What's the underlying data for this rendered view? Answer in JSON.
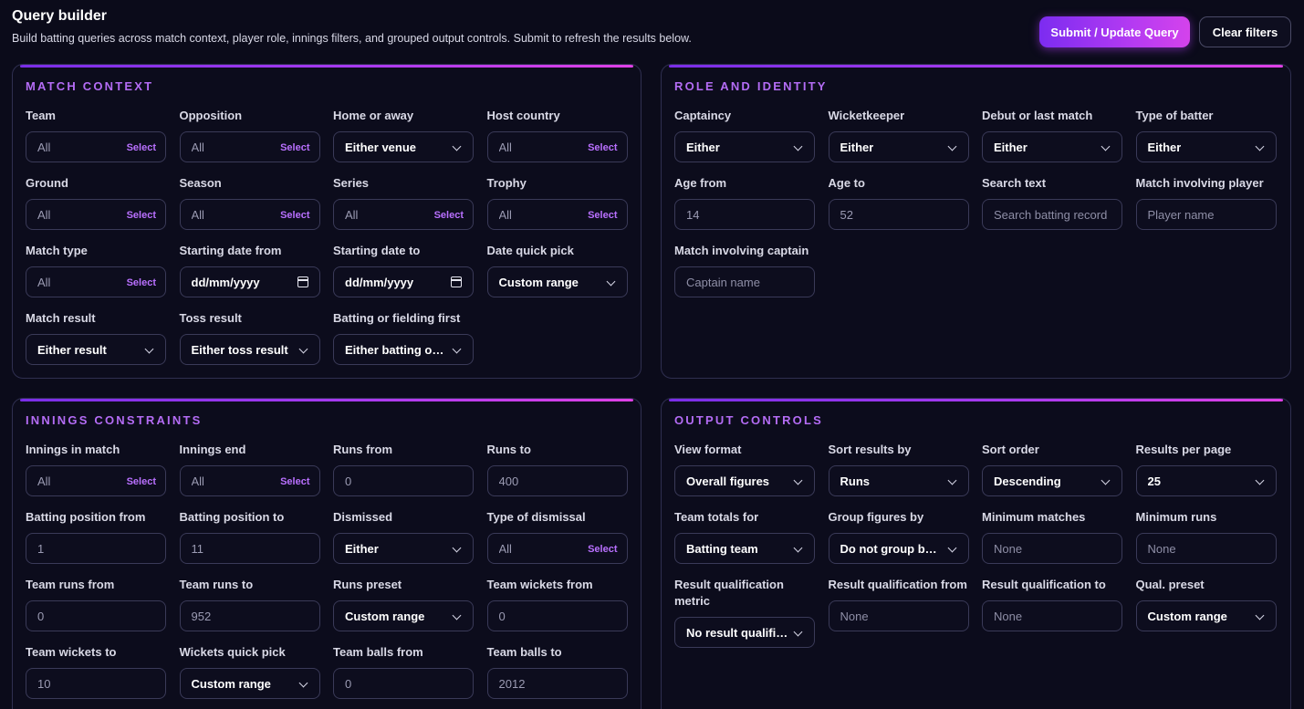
{
  "header": {
    "title": "Query builder",
    "subtitle": "Build batting queries across match context, player role, innings filters, and grouped output controls. Submit to refresh the results below.",
    "submit_label": "Submit / Update Query",
    "clear_label": "Clear filters"
  },
  "select_tag": "Select",
  "match_context": {
    "title": "MATCH CONTEXT",
    "fields": [
      {
        "label": "Team",
        "kind": "multi",
        "value": "All"
      },
      {
        "label": "Opposition",
        "kind": "multi",
        "value": "All"
      },
      {
        "label": "Home or away",
        "kind": "select",
        "value": "Either venue"
      },
      {
        "label": "Host country",
        "kind": "multi",
        "value": "All"
      },
      {
        "label": "Ground",
        "kind": "multi",
        "value": "All"
      },
      {
        "label": "Season",
        "kind": "multi",
        "value": "All"
      },
      {
        "label": "Series",
        "kind": "multi",
        "value": "All"
      },
      {
        "label": "Trophy",
        "kind": "multi",
        "value": "All"
      },
      {
        "label": "Match type",
        "kind": "multi",
        "value": "All"
      },
      {
        "label": "Starting date from",
        "kind": "date",
        "value": "dd/mm/yyyy"
      },
      {
        "label": "Starting date to",
        "kind": "date",
        "value": "dd/mm/yyyy"
      },
      {
        "label": "Date quick pick",
        "kind": "select",
        "value": "Custom range"
      },
      {
        "label": "Match result",
        "kind": "select",
        "value": "Either result"
      },
      {
        "label": "Toss result",
        "kind": "select",
        "value": "Either toss result"
      },
      {
        "label": "Batting or fielding first",
        "kind": "select",
        "value": "Either batting or fielding first"
      }
    ]
  },
  "role_identity": {
    "title": "ROLE AND IDENTITY",
    "fields": [
      {
        "label": "Captaincy",
        "kind": "select",
        "value": "Either"
      },
      {
        "label": "Wicketkeeper",
        "kind": "select",
        "value": "Either"
      },
      {
        "label": "Debut or last match",
        "kind": "select",
        "value": "Either"
      },
      {
        "label": "Type of batter",
        "kind": "select",
        "value": "Either"
      },
      {
        "label": "Age from",
        "kind": "input",
        "value": "14"
      },
      {
        "label": "Age to",
        "kind": "input",
        "value": "52"
      },
      {
        "label": "Search text",
        "kind": "input",
        "value": "",
        "placeholder": "Search batting record"
      },
      {
        "label": "Match involving player",
        "kind": "input",
        "value": "",
        "placeholder": "Player name"
      },
      {
        "label": "Match involving captain",
        "kind": "input",
        "value": "",
        "placeholder": "Captain name"
      }
    ]
  },
  "innings_constraints": {
    "title": "INNINGS CONSTRAINTS",
    "fields": [
      {
        "label": "Innings in match",
        "kind": "multi",
        "value": "All"
      },
      {
        "label": "Innings end",
        "kind": "multi",
        "value": "All"
      },
      {
        "label": "Runs from",
        "kind": "input",
        "value": "0"
      },
      {
        "label": "Runs to",
        "kind": "input",
        "value": "400"
      },
      {
        "label": "Batting position from",
        "kind": "input",
        "value": "1"
      },
      {
        "label": "Batting position to",
        "kind": "input",
        "value": "11"
      },
      {
        "label": "Dismissed",
        "kind": "select",
        "value": "Either"
      },
      {
        "label": "Type of dismissal",
        "kind": "multi",
        "value": "All"
      },
      {
        "label": "Team runs from",
        "kind": "input",
        "value": "0"
      },
      {
        "label": "Team runs to",
        "kind": "input",
        "value": "952"
      },
      {
        "label": "Runs preset",
        "kind": "select",
        "value": "Custom range"
      },
      {
        "label": "Team wickets from",
        "kind": "input",
        "value": "0"
      },
      {
        "label": "Team wickets to",
        "kind": "input",
        "value": "10"
      },
      {
        "label": "Wickets quick pick",
        "kind": "select",
        "value": "Custom range"
      },
      {
        "label": "Team balls from",
        "kind": "input",
        "value": "0"
      },
      {
        "label": "Team balls to",
        "kind": "input",
        "value": "2012"
      }
    ]
  },
  "output_controls": {
    "title": "OUTPUT CONTROLS",
    "fields": [
      {
        "label": "View format",
        "kind": "select",
        "value": "Overall figures"
      },
      {
        "label": "Sort results by",
        "kind": "select",
        "value": "Runs"
      },
      {
        "label": "Sort order",
        "kind": "select",
        "value": "Descending"
      },
      {
        "label": "Results per page",
        "kind": "select",
        "value": "25"
      },
      {
        "label": "Team totals for",
        "kind": "select",
        "value": "Batting team"
      },
      {
        "label": "Group figures by",
        "kind": "select",
        "value": "Do not group by anything"
      },
      {
        "label": "Minimum matches",
        "kind": "input",
        "value": "",
        "placeholder": "None"
      },
      {
        "label": "Minimum runs",
        "kind": "input",
        "value": "",
        "placeholder": "None"
      },
      {
        "label": "Result qualification metric",
        "kind": "select",
        "value": "No result qualification"
      },
      {
        "label": "Result qualification from",
        "kind": "input",
        "value": "",
        "placeholder": "None"
      },
      {
        "label": "Result qualification to",
        "kind": "input",
        "value": "",
        "placeholder": "None"
      },
      {
        "label": "Qual. preset",
        "kind": "select",
        "value": "Custom range"
      }
    ]
  }
}
